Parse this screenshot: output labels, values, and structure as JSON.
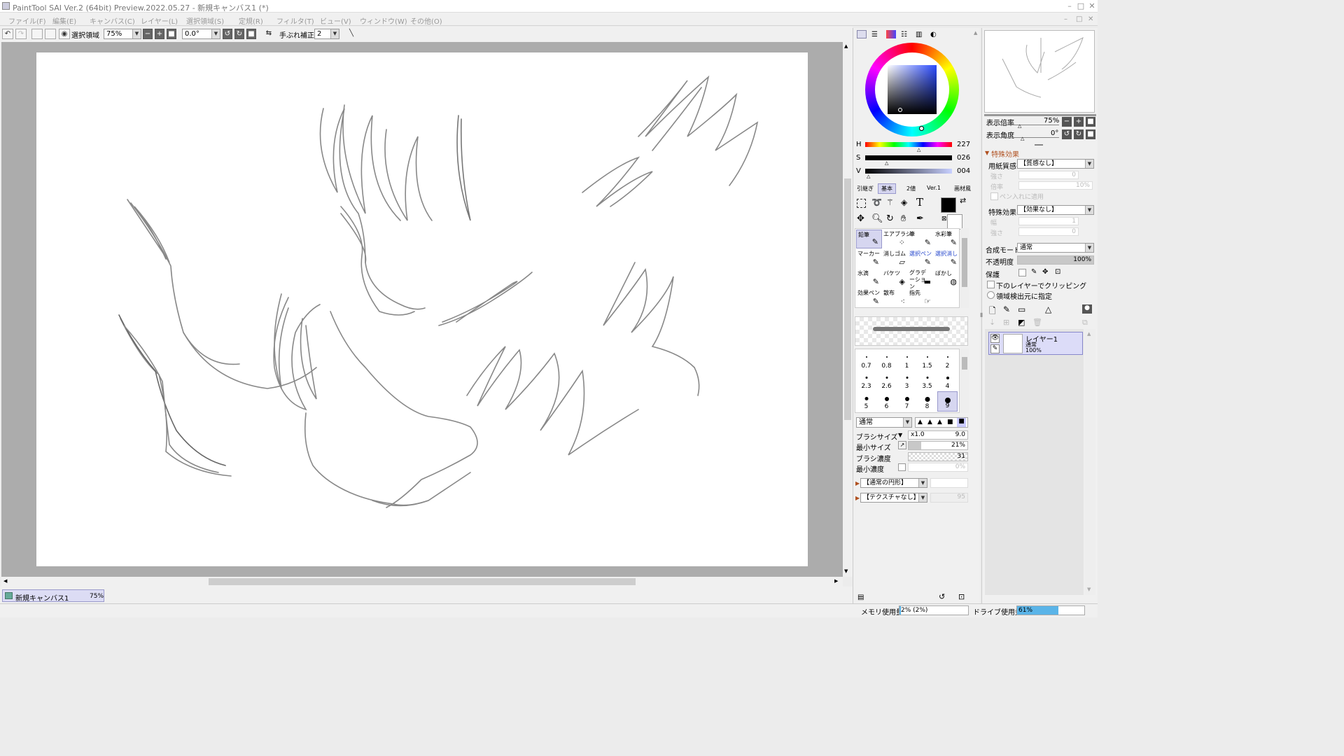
{
  "window": {
    "title": "PaintTool SAI Ver.2 (64bit) Preview.2022.05.27 - 新規キャンバス1 (*)",
    "min": "–",
    "max": "□",
    "close": "✕"
  },
  "menu": [
    "ファイル(F)",
    "編集(E)",
    "キャンバス(C)",
    "レイヤー(L)",
    "選択領域(S)",
    "定規(R)",
    "フィルタ(T)",
    "ビュー(V)",
    "ウィンドウ(W)",
    "その他(O)"
  ],
  "toolbar": {
    "selection_label": "選択領域",
    "zoom_value": "75%",
    "angle_value": "0.0°",
    "stabilizer_label": "手ぶれ補正",
    "stabilizer_value": "2"
  },
  "tabs": [
    {
      "name": "新規キャンバス1",
      "zoom": "75%"
    }
  ],
  "color": {
    "current": "#000000",
    "h_label": "H",
    "h_value": "227",
    "s_label": "S",
    "s_value": "026",
    "v_label": "V",
    "v_value": "004"
  },
  "tool_sets": [
    "引継ぎ",
    "基本",
    "2値",
    "Ver.1",
    "画材風"
  ],
  "tools": [
    {
      "name": "鉛筆",
      "icon": "pencil-icon",
      "glyph": "✎"
    },
    {
      "name": "エアブラシ",
      "icon": "airbrush-icon",
      "glyph": "⁘"
    },
    {
      "name": "筆",
      "icon": "brush-icon",
      "glyph": "✎"
    },
    {
      "name": "水彩筆",
      "icon": "watercolor-icon",
      "glyph": "✎"
    },
    {
      "name": "マーカー",
      "icon": "marker-icon",
      "glyph": "✎"
    },
    {
      "name": "消しゴム",
      "icon": "eraser-icon",
      "glyph": "▱"
    },
    {
      "name": "選択ペン",
      "icon": "select-pen-icon",
      "glyph": "✎"
    },
    {
      "name": "選択消し",
      "icon": "select-erase-icon",
      "glyph": "✎"
    },
    {
      "name": "水滴",
      "icon": "droplet-icon",
      "glyph": "✎"
    },
    {
      "name": "バケツ",
      "icon": "bucket-icon",
      "glyph": "◈"
    },
    {
      "name": "グラデーション",
      "icon": "gradient-icon",
      "glyph": "▬"
    },
    {
      "name": "ぼかし",
      "icon": "blur-icon",
      "glyph": "◍"
    },
    {
      "name": "効果ペン",
      "icon": "effect-pen-icon",
      "glyph": "✎"
    },
    {
      "name": "散布",
      "icon": "scatter-icon",
      "glyph": "⁖"
    },
    {
      "name": "指先",
      "icon": "finger-icon",
      "glyph": "☞"
    }
  ],
  "brush_sizes": [
    "0.7",
    "0.8",
    "1",
    "1.5",
    "2",
    "2.3",
    "2.6",
    "3",
    "3.5",
    "4",
    "5",
    "6",
    "7",
    "8",
    "9"
  ],
  "brush": {
    "blend": "通常",
    "size_label": "ブラシサイズ",
    "size_mult": "x1.0",
    "size_value": "9.0",
    "min_size_label": "最小サイズ",
    "min_size_value": "21%",
    "density_label": "ブラシ濃度",
    "density_value": "31",
    "min_density_label": "最小濃度",
    "min_density_value": "0%",
    "shape": "【通常の円形】",
    "texture": "【テクスチャなし】",
    "texture_value": "95"
  },
  "navigator": {
    "zoom_label": "表示倍率",
    "zoom_value": "75%",
    "angle_label": "表示角度",
    "angle_value": "0°"
  },
  "effects": {
    "header": "特殊効果",
    "paper_label": "用紙質感",
    "paper_value": "【質感なし】",
    "strength_label": "強さ",
    "strength_value": "0",
    "scale_label": "倍率",
    "scale_value": "10%",
    "pen_apply_label": "ペン入れに適用",
    "effect_label": "特殊効果",
    "effect_value": "【効果なし】",
    "width_label": "幅",
    "width_value": "1",
    "effect_strength_label": "強さ",
    "effect_strength_value": "0"
  },
  "layer_props": {
    "blend_label": "合成モード",
    "blend_value": "通常",
    "opacity_label": "不透明度",
    "opacity_value": "100%",
    "protect_label": "保護",
    "clip_label": "下のレイヤーでクリッピング",
    "source_label": "領域検出元に指定"
  },
  "layers": [
    {
      "name": "レイヤー1",
      "mode": "通常",
      "opacity": "100%"
    }
  ],
  "status": {
    "memory_label": "メモリ使用量",
    "memory_value": "2% (2%)",
    "drive_label": "ドライブ使用量",
    "drive_value": "61%",
    "drive_fraction": 0.61
  }
}
